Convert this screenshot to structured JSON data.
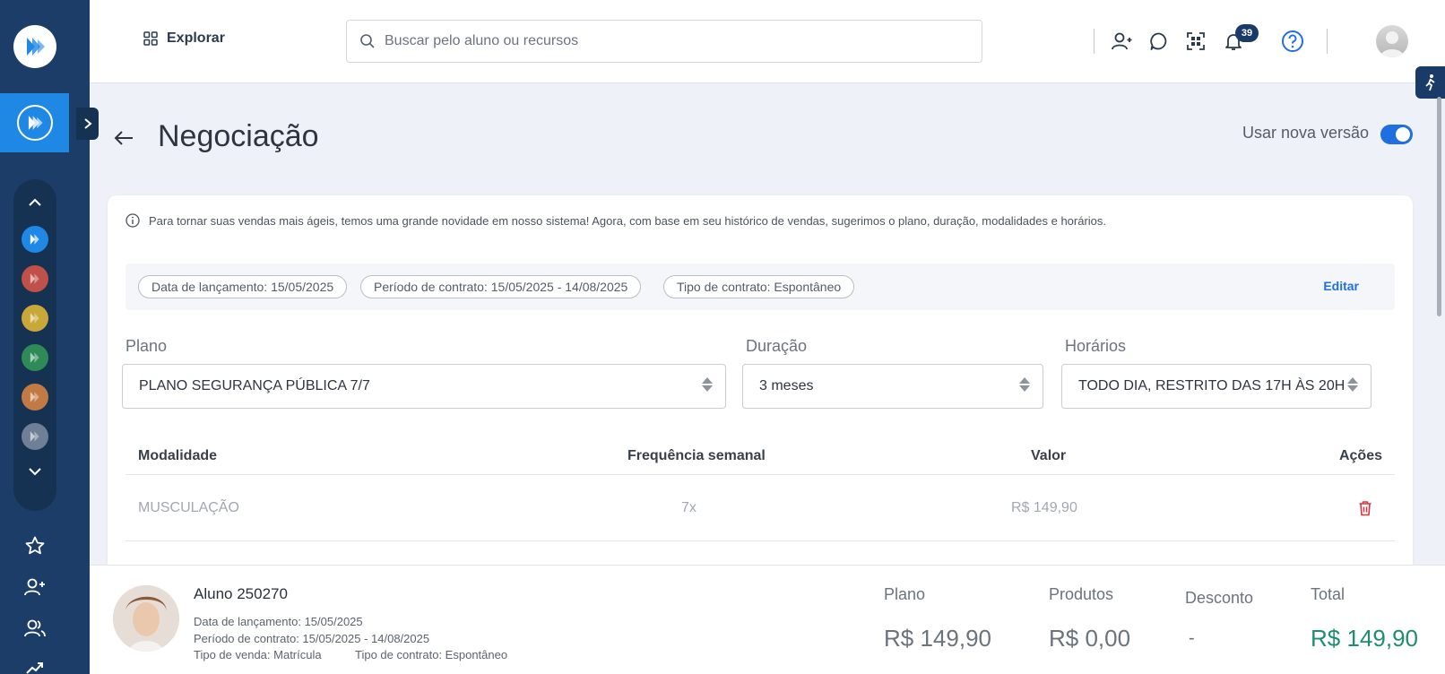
{
  "topbar": {
    "explorar_label": "Explorar",
    "search_placeholder": "Buscar pelo aluno ou recursos",
    "notification_count": "39"
  },
  "page": {
    "title": "Negociação",
    "toggle_label": "Usar nova versão",
    "toggle_on": true
  },
  "card": {
    "info_text": "Para tornar suas vendas mais ágeis, temos uma grande novidade em nosso sistema! Agora, com base em seu histórico de vendas, sugerimos o plano, duração, modalidades e horários.",
    "chips": [
      "Data de lançamento: 15/05/2025",
      "Período de contrato: 15/05/2025 - 14/08/2025",
      "Tipo de contrato: Espontâneo"
    ],
    "edit_label": "Editar",
    "fields": {
      "plano": {
        "label": "Plano",
        "value": "PLANO SEGURANÇA PÚBLICA 7/7"
      },
      "duracao": {
        "label": "Duração",
        "value": "3 meses"
      },
      "horarios": {
        "label": "Horários",
        "value": "TODO DIA, RESTRITO DAS 17H ÀS 20H"
      }
    },
    "table": {
      "headers": [
        "Modalidade",
        "Frequência semanal",
        "Valor",
        "Ações"
      ],
      "rows": [
        {
          "modalidade": "MUSCULAÇÃO",
          "frequencia": "7x",
          "valor": "R$ 149,90"
        }
      ]
    }
  },
  "footer": {
    "student_name": "Aluno 250270",
    "data_lancamento": "Data de lançamento: 15/05/2025",
    "periodo": "Período de contrato: 15/05/2025 - 14/08/2025",
    "tipo_venda": "Tipo de venda: Matrícula",
    "tipo_contrato": "Tipo de contrato: Espontâneo",
    "summary": {
      "plano_label": "Plano",
      "plano_value": "R$ 149,90",
      "produtos_label": "Produtos",
      "produtos_value": "R$ 0,00",
      "desconto_label": "Desconto",
      "desconto_value": "-",
      "total_label": "Total",
      "total_value": "R$ 149,90"
    }
  },
  "colors": {
    "sidebar": "#1d3d69",
    "active_tile": "#1f88e5",
    "accent": "#1f6fe0",
    "total": "#1e8e6e",
    "delete": "#d9363e",
    "app_dots": [
      "#1f88e5",
      "#c0504a",
      "#c9a83a",
      "#2e8b57",
      "#c27a45",
      "#6f7f95"
    ]
  },
  "icons": {
    "sidebar": [
      "logo-icon",
      "expand-chevron-icon",
      "chevron-up-icon",
      "chevron-down-icon",
      "star-icon",
      "add-user-icon",
      "users-icon",
      "trend-icon"
    ],
    "topbar": [
      "grid-icon",
      "search-icon",
      "add-user-icon",
      "chat-icon",
      "qr-code-icon",
      "bell-icon",
      "help-icon",
      "avatar"
    ]
  }
}
